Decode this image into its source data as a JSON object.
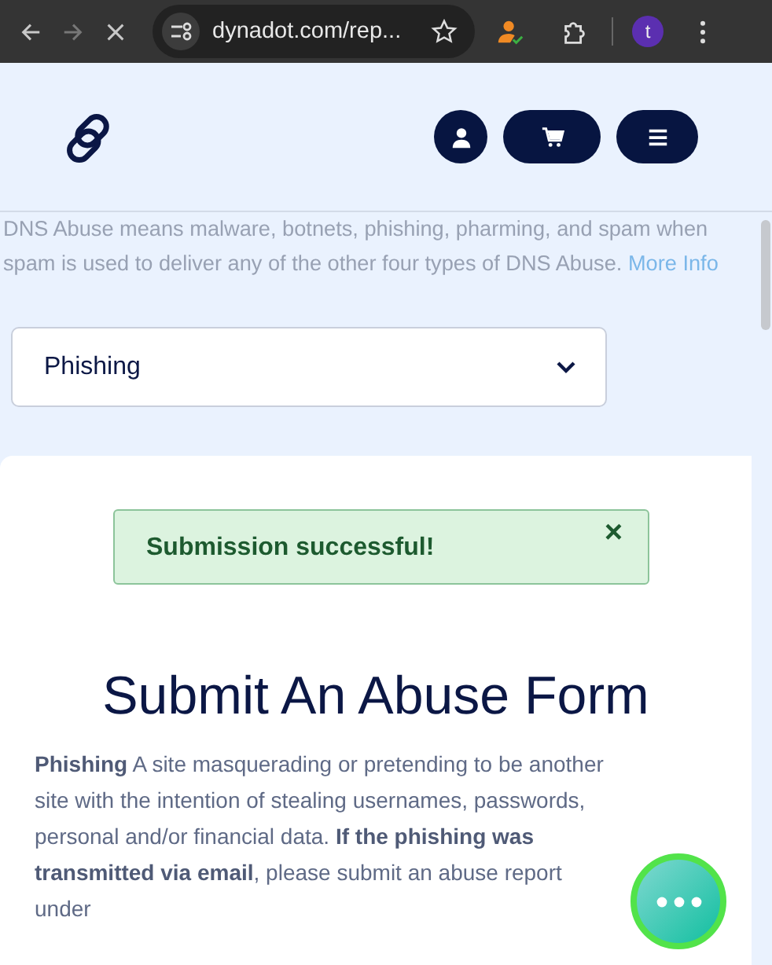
{
  "browser": {
    "forward": {
      "disabled": true
    },
    "address": "dynadot.com/rep...",
    "avatar": "t"
  },
  "intro": {
    "text": "DNS Abuse means malware, botnets, phishing, pharming, and spam when spam is used to deliver any of the other four types of DNS Abuse.",
    "link": "More Info"
  },
  "abuse_type": {
    "value": "Phishing"
  },
  "alert": {
    "message": "Submission successful!",
    "close": "×"
  },
  "form": {
    "title": "Submit An Abuse Form",
    "description": "**Phishing** A site masquerading or pretending to be another site with the intention of stealing usernames, passwords, personal and/or financial data. **If the phishing was transmitted via email**, please submit an abuse report under"
  }
}
